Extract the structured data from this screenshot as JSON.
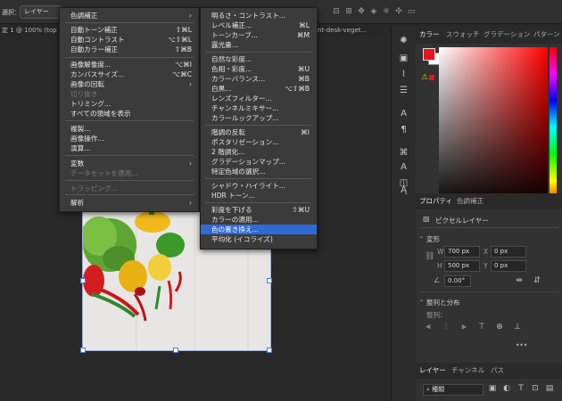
{
  "option_bar": {
    "select_label": "選択：",
    "select_value": "レイヤー",
    "icons": [
      "align-left-icon",
      "align-center-icon",
      "align-right-icon",
      "distribute-icon",
      "3d-rotate-icon",
      "3d-roll-icon",
      "3d-pan-icon",
      "3d-slide-icon",
      "3d-scale-icon",
      "video-icon"
    ]
  },
  "document_tabs": [
    {
      "label": "定 1 @ 100% (top-vi"
    },
    {
      "label": "nt-desk-veget..."
    }
  ],
  "image_menu": {
    "items": [
      {
        "label": "色調補正",
        "shortcut": "",
        "submenu": true,
        "highlighted": true
      },
      {
        "label": "自動トーン補正",
        "shortcut": "⇧⌘L"
      },
      {
        "label": "自動コントラスト",
        "shortcut": "⌥⇧⌘L"
      },
      {
        "label": "自動カラー補正",
        "shortcut": "⇧⌘B"
      },
      {
        "label": "画像解像度...",
        "shortcut": "⌥⌘I"
      },
      {
        "label": "カンバスサイズ...",
        "shortcut": "⌥⌘C"
      },
      {
        "label": "画像の回転",
        "shortcut": "",
        "submenu": true
      },
      {
        "label": "切り抜き",
        "shortcut": "",
        "disabled": true
      },
      {
        "label": "トリミング...",
        "shortcut": ""
      },
      {
        "label": "すべての領域を表示",
        "shortcut": ""
      },
      {
        "label": "複製...",
        "shortcut": ""
      },
      {
        "label": "画像操作...",
        "shortcut": ""
      },
      {
        "label": "演算...",
        "shortcut": ""
      },
      {
        "label": "変数",
        "shortcut": "",
        "submenu": true
      },
      {
        "label": "データセットを適用...",
        "shortcut": "",
        "disabled": true
      },
      {
        "label": "トラッピング...",
        "shortcut": "",
        "disabled": true
      },
      {
        "label": "解析",
        "shortcut": "",
        "submenu": true
      }
    ]
  },
  "adjust_menu": {
    "items": [
      {
        "label": "明るさ・コントラスト...",
        "shortcut": ""
      },
      {
        "label": "レベル補正...",
        "shortcut": "⌘L"
      },
      {
        "label": "トーンカーブ...",
        "shortcut": "⌘M"
      },
      {
        "label": "露光量...",
        "shortcut": ""
      },
      {
        "label": "自然な彩度...",
        "shortcut": ""
      },
      {
        "label": "色相・彩度...",
        "shortcut": "⌘U"
      },
      {
        "label": "カラーバランス...",
        "shortcut": "⌘B"
      },
      {
        "label": "白黒...",
        "shortcut": "⌥⇧⌘B"
      },
      {
        "label": "レンズフィルター...",
        "shortcut": ""
      },
      {
        "label": "チャンネルミキサー...",
        "shortcut": ""
      },
      {
        "label": "カラールックアップ...",
        "shortcut": ""
      },
      {
        "label": "階調の反転",
        "shortcut": "⌘I"
      },
      {
        "label": "ポスタリゼーション...",
        "shortcut": ""
      },
      {
        "label": "2 階調化...",
        "shortcut": ""
      },
      {
        "label": "グラデーションマップ...",
        "shortcut": ""
      },
      {
        "label": "特定色域の選択...",
        "shortcut": ""
      },
      {
        "label": "シャドウ・ハイライト...",
        "shortcut": ""
      },
      {
        "label": "HDR トーン...",
        "shortcut": ""
      },
      {
        "label": "彩度を下げる",
        "shortcut": "⇧⌘U"
      },
      {
        "label": "カラーの適用...",
        "shortcut": ""
      },
      {
        "label": "色の置き換え...",
        "shortcut": "",
        "highlighted": true
      },
      {
        "label": "平均化 (イコライズ)",
        "shortcut": ""
      }
    ]
  },
  "color_panel": {
    "tabs": [
      "カラー",
      "スウォッチ",
      "グラデーション",
      "パターン"
    ],
    "foreground_color": "#e8141b",
    "background_color": "#ffffff",
    "hue_color": "#ff0000"
  },
  "properties_panel": {
    "tabs": [
      "プロパティ",
      "色調補正"
    ],
    "layer_type": "ピクセルレイヤー",
    "transform_title": "変形",
    "w_label": "W",
    "w_value": "700 px",
    "x_label": "X",
    "x_value": "0 px",
    "h_label": "H",
    "h_value": "500 px",
    "y_label": "Y",
    "y_value": "0 px",
    "angle_value": "0.00°",
    "align_title": "整列と分布",
    "align_label": "整列：",
    "more": "•••"
  },
  "layers_panel": {
    "tabs": [
      "レイヤー",
      "チャンネル",
      "パス"
    ],
    "filter_value": "種類"
  },
  "accent_color": "#2f6ad6"
}
